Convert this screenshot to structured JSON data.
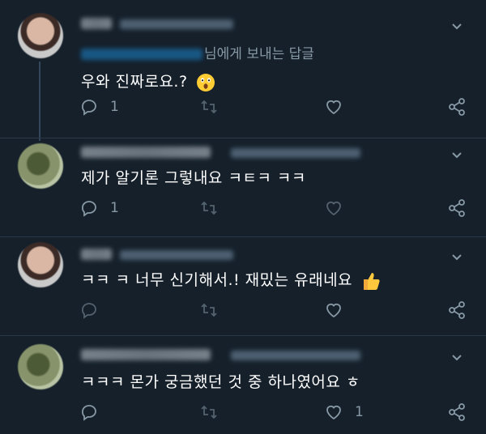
{
  "colors": {
    "background": "#15202b",
    "text": "#ffffff",
    "secondary": "#8899a6",
    "mention": "#1d9bf0"
  },
  "tweets": [
    {
      "reply_suffix": "님에게 보내는 답글",
      "text": "우와 진짜로요.?",
      "emoji": "astonished-face",
      "reply_count": "1",
      "retweet_count": "",
      "like_count": ""
    },
    {
      "text": "제가 알기론 그렇내요 ㅋㅌㅋ ㅋㅋ",
      "reply_count": "1",
      "retweet_count": "",
      "like_count": ""
    },
    {
      "text": "ㅋㅋ ㅋ 너무 신기해서.! 재밌는 유래네요",
      "emoji": "thumbs-up",
      "reply_count": "",
      "retweet_count": "",
      "like_count": ""
    },
    {
      "text": "ㅋㅋㅋ 몬가 궁금했던 것 중 하나였어요 ㅎ",
      "reply_count": "",
      "retweet_count": "",
      "like_count": "1"
    }
  ]
}
